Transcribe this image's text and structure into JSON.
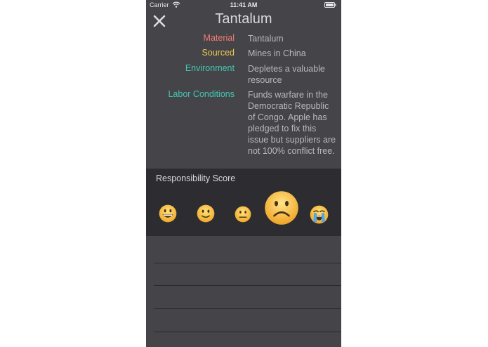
{
  "status_bar": {
    "carrier": "Carrier",
    "time": "11:41 AM"
  },
  "header": {
    "title": "Tantalum",
    "close_icon": "close-x"
  },
  "details": [
    {
      "label": "Material",
      "value": "Tantalum",
      "color": "#f07b73"
    },
    {
      "label": "Sourced",
      "value": "Mines in China",
      "color": "#ecc94f"
    },
    {
      "label": "Environment",
      "value": "Depletes a valuable resource",
      "color": "#43c7b2"
    },
    {
      "label": "Labor Conditions",
      "value": "Funds warfare in the Democratic Republic of Congo. Apple has pledged to fix this issue but suppliers are not 100% conflict free.",
      "color": "#43c7b2"
    }
  ],
  "responsibility": {
    "title": "Responsibility Score",
    "selected_index": 3,
    "faces": [
      {
        "icon": "grinning-face-emoji"
      },
      {
        "icon": "slightly-smiling-face-emoji"
      },
      {
        "icon": "neutral-face-emoji"
      },
      {
        "icon": "frowning-face-emoji"
      },
      {
        "icon": "crying-face-emoji"
      }
    ]
  },
  "colors": {
    "background": "#454449",
    "panel": "#2c2c31",
    "text_muted": "#b7b7bd"
  }
}
